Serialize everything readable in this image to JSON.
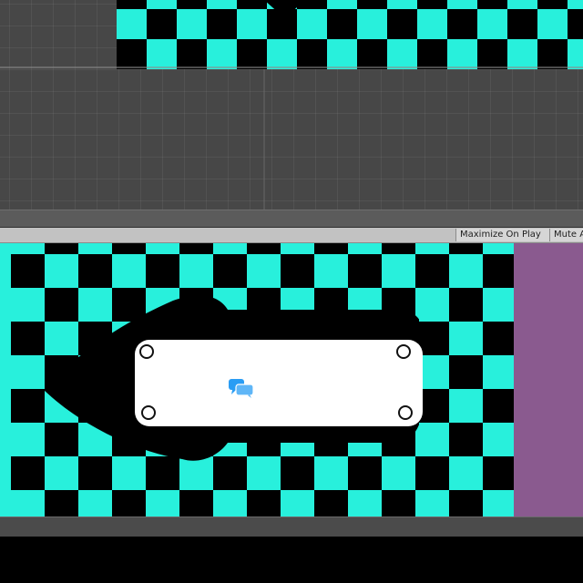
{
  "game_toolbar": {
    "maximize_on_play": "Maximize On Play",
    "mute_audio": "Mute A"
  },
  "colors": {
    "checker_cyan": "#28f0dc",
    "checker_black": "#000000",
    "side_panel": "#8a5a8f",
    "editor_gray": "#474747",
    "chat_icon": "#2a9df4"
  },
  "icons": {
    "chat": "speech-bubbles-icon",
    "handle": "resize-handle-icon"
  }
}
